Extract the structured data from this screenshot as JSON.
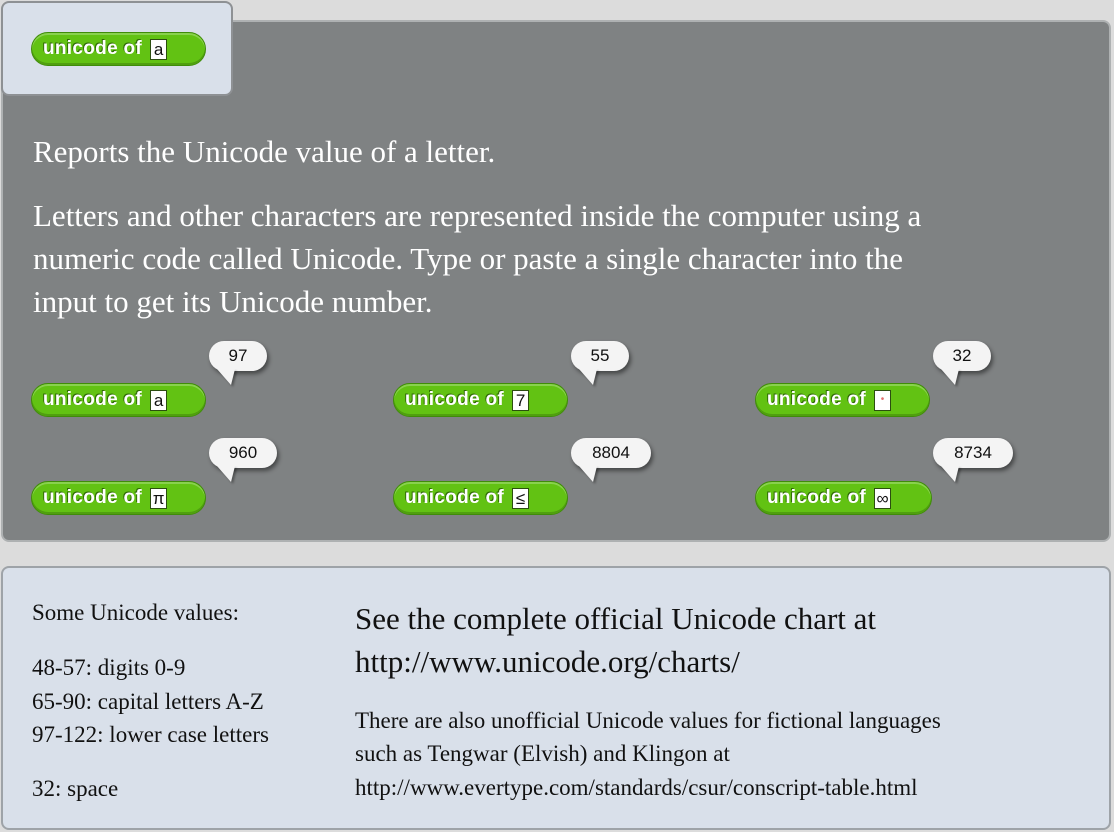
{
  "header_block": {
    "label": "unicode of",
    "input": "a"
  },
  "description": {
    "summary": "Reports the Unicode value of a letter.",
    "details": [
      "Letters and other characters are represented inside the computer using a",
      "numeric code called Unicode. Type or paste a single character into the",
      "input to get its Unicode number."
    ]
  },
  "examples": [
    {
      "label": "unicode of",
      "input": "a",
      "result": "97"
    },
    {
      "label": "unicode of",
      "input": "7",
      "result": "55"
    },
    {
      "label": "unicode of",
      "input": "•",
      "result": "32"
    },
    {
      "label": "unicode of",
      "input": "π",
      "result": "960"
    },
    {
      "label": "unicode of",
      "input": "≤",
      "result": "8804"
    },
    {
      "label": "unicode of",
      "input": "∞",
      "result": "8734"
    }
  ],
  "info": {
    "values_heading": "Some Unicode values:",
    "values": [
      "48-57: digits 0-9",
      "65-90: capital letters A-Z",
      "97-122: lower case letters",
      "32: space"
    ],
    "chart_lines": [
      "See the complete official Unicode chart at",
      "http://www.unicode.org/charts/"
    ],
    "unofficial_lines": [
      "There are also unofficial Unicode values for fictional languages",
      "such as Tengwar (Elvish) and Klingon at",
      "http://www.evertype.com/standards/csur/conscript-table.html"
    ]
  },
  "colors": {
    "block_green": "#62c213",
    "panel_gray": "#7f8283",
    "info_panel": "#d9e0ea",
    "bubble": "#f4f4f4"
  }
}
